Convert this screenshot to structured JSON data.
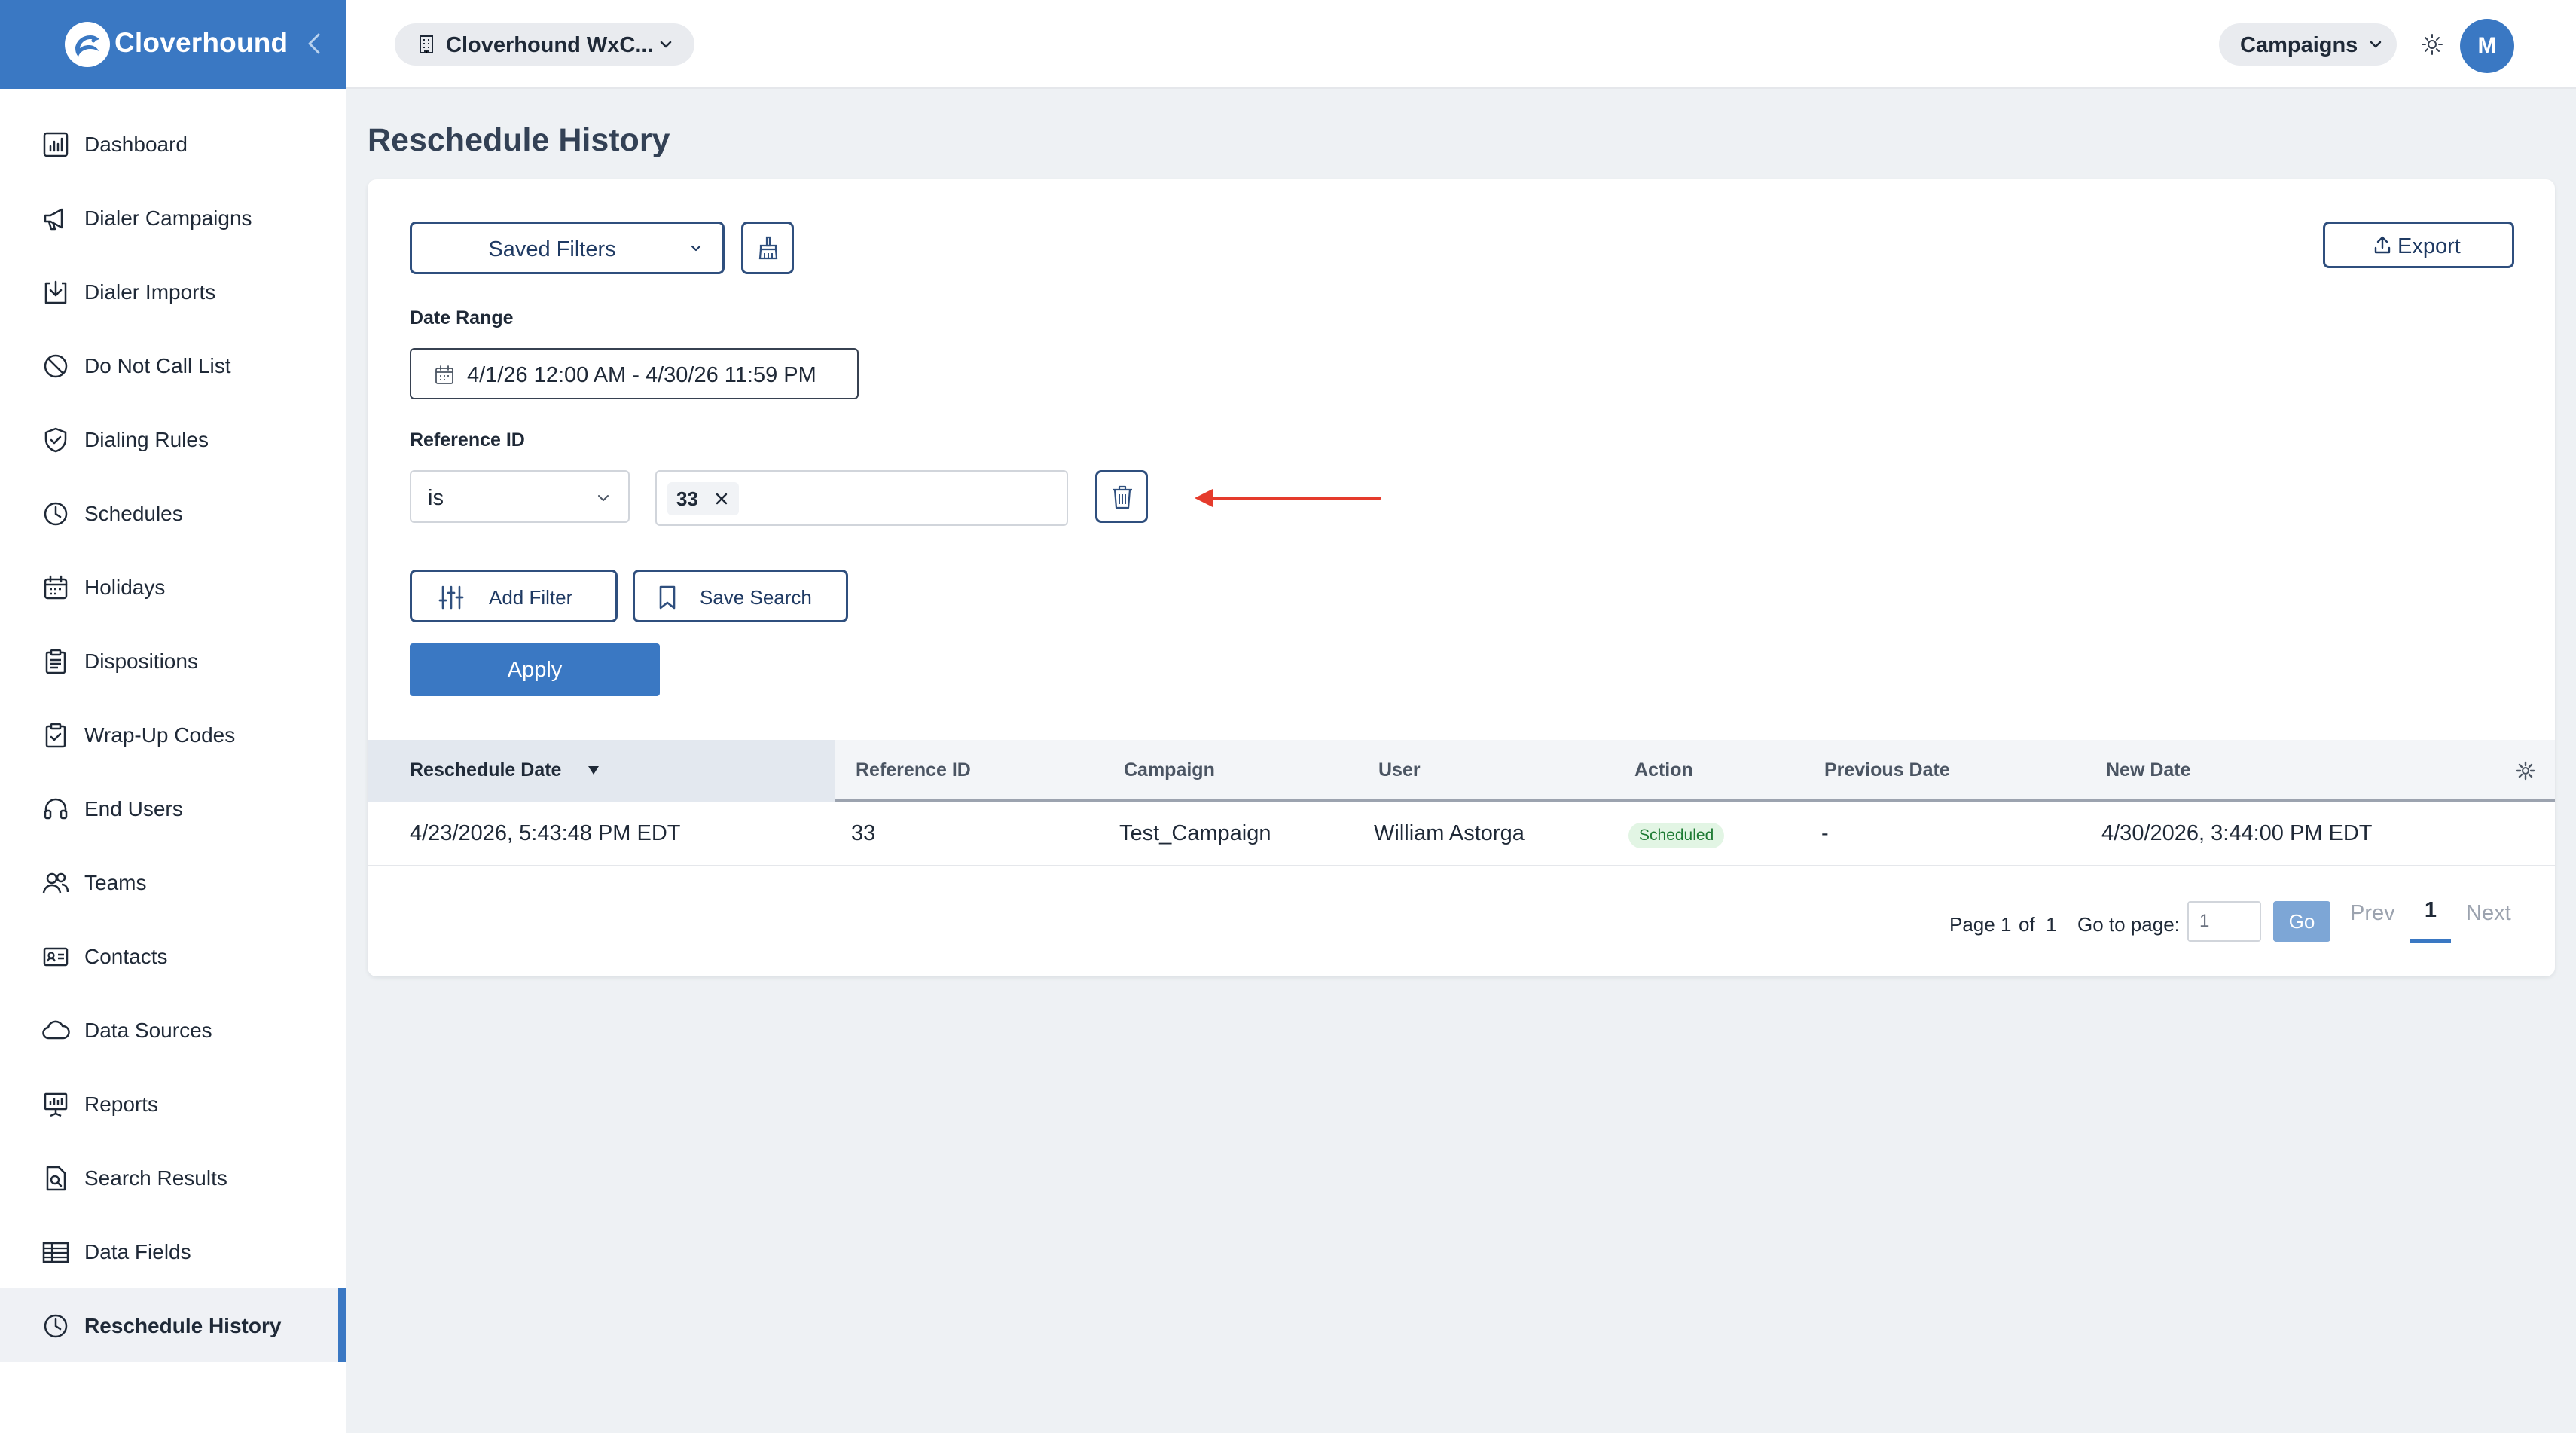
{
  "brand": {
    "name": "Cloverhound"
  },
  "topbar": {
    "org_label": "Cloverhound WxC...",
    "campaigns_label": "Campaigns",
    "avatar_initial": "M"
  },
  "sidebar": {
    "items": [
      {
        "label": "Dashboard",
        "icon": "dashboard-icon"
      },
      {
        "label": "Dialer Campaigns",
        "icon": "megaphone-icon"
      },
      {
        "label": "Dialer Imports",
        "icon": "import-icon"
      },
      {
        "label": "Do Not Call List",
        "icon": "ban-icon"
      },
      {
        "label": "Dialing Rules",
        "icon": "shield-check-icon"
      },
      {
        "label": "Schedules",
        "icon": "clock-icon"
      },
      {
        "label": "Holidays",
        "icon": "calendar-icon"
      },
      {
        "label": "Dispositions",
        "icon": "clipboard-icon"
      },
      {
        "label": "Wrap-Up Codes",
        "icon": "clipboard-check-icon"
      },
      {
        "label": "End Users",
        "icon": "headset-icon"
      },
      {
        "label": "Teams",
        "icon": "users-icon"
      },
      {
        "label": "Contacts",
        "icon": "contact-card-icon"
      },
      {
        "label": "Data Sources",
        "icon": "cloud-icon"
      },
      {
        "label": "Reports",
        "icon": "presentation-icon"
      },
      {
        "label": "Search Results",
        "icon": "file-search-icon"
      },
      {
        "label": "Data Fields",
        "icon": "table-icon"
      },
      {
        "label": "Reschedule History",
        "icon": "clock-icon",
        "active": true
      }
    ]
  },
  "page": {
    "title": "Reschedule History"
  },
  "filters": {
    "saved_filters_label": "Saved Filters",
    "export_label": "Export",
    "date_range_label": "Date Range",
    "date_range_value": "4/1/26 12:00 AM - 4/30/26 11:59 PM",
    "reference_id_label": "Reference ID",
    "operator_value": "is",
    "chip_value": "33",
    "add_filter_label": "Add Filter",
    "save_search_label": "Save Search",
    "apply_label": "Apply"
  },
  "table": {
    "columns": [
      "Reschedule Date",
      "Reference ID",
      "Campaign",
      "User",
      "Action",
      "Previous Date",
      "New Date"
    ],
    "sorted_column": "Reschedule Date",
    "sort_direction": "descending",
    "rows": [
      {
        "reschedule_date": "4/23/2026, 5:43:48 PM EDT",
        "reference_id": "33",
        "campaign": "Test_Campaign",
        "user": "William Astorga",
        "action": "Scheduled",
        "previous_date": "-",
        "new_date": "4/30/2026, 3:44:00 PM EDT"
      }
    ]
  },
  "pagination": {
    "page_prefix": "Page",
    "current_page": "1",
    "of_label": "of",
    "total_pages": "1",
    "goto_label": "Go to page:",
    "goto_value": "1",
    "go_label": "Go",
    "prev_label": "Prev",
    "next_label": "Next"
  },
  "colors": {
    "brand": "#3a78c3",
    "sidebar_bg": "#ffffff",
    "page_bg": "#eef1f4",
    "outline_button": "#2f4f7e",
    "annotation_arrow": "#e53b2c",
    "status_scheduled_bg": "#e2f5e4",
    "status_scheduled_text": "#1e7b34"
  }
}
